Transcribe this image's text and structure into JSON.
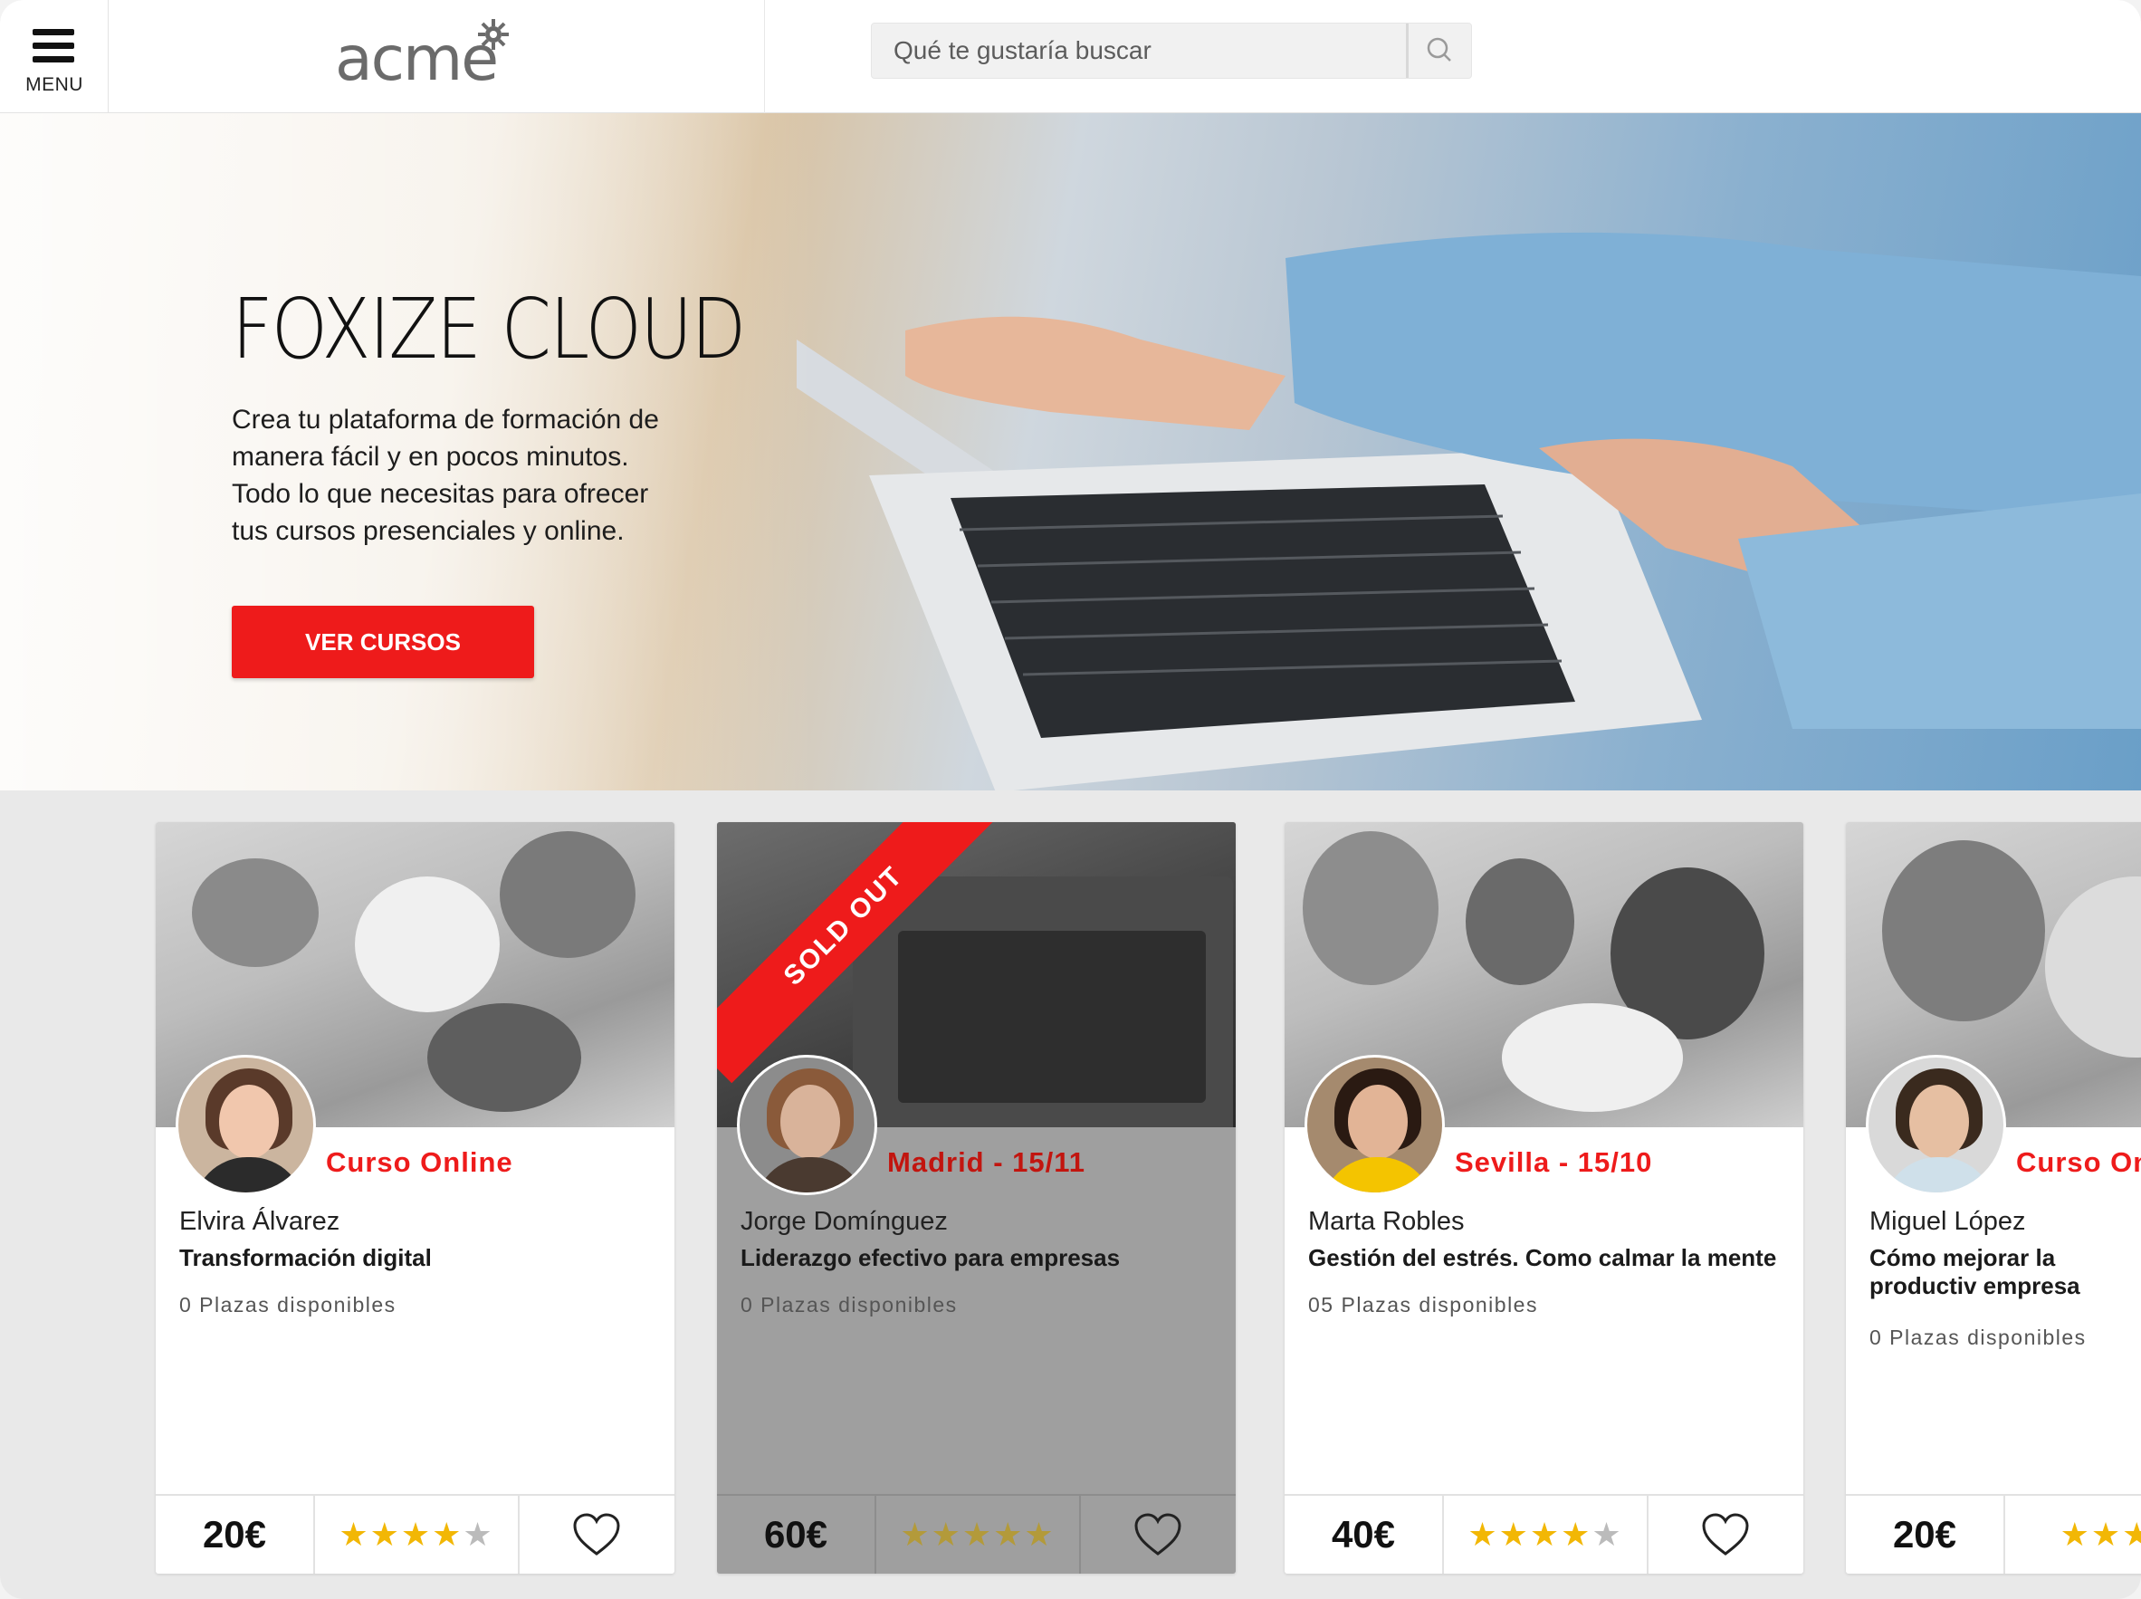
{
  "header": {
    "menu_label": "MENU",
    "logo_text": "acme",
    "search_placeholder": "Qué te gustaría buscar"
  },
  "hero": {
    "title": "FOXIZE CLOUD",
    "description_lines": [
      "Crea tu plataforma de formación de",
      "manera fácil y en pocos minutos.",
      "Todo lo que necesitas para ofrecer",
      "tus cursos presenciales y online."
    ],
    "cta_label": "VER CURSOS"
  },
  "colors": {
    "accent": "#ee1b1b",
    "star": "#f2b705",
    "sold_out_overlay": "#9f9f9f"
  },
  "cards": [
    {
      "tag": "Curso Online",
      "name": "Elvira Álvarez",
      "course": "Transformación digital",
      "seats": "0 Plazas disponibles",
      "price": "20€",
      "rating": 4.5,
      "sold_out": false
    },
    {
      "ribbon": "SOLD OUT",
      "tag": "Madrid - 15/11",
      "name": "Jorge Domínguez",
      "course": "Liderazgo efectivo para empresas",
      "seats": "0 Plazas disponibles",
      "price": "60€",
      "rating": 5,
      "sold_out": true
    },
    {
      "tag": "Sevilla - 15/10",
      "name": "Marta Robles",
      "course": "Gestión del estrés. Como calmar la mente",
      "seats": "05 Plazas disponibles",
      "price": "40€",
      "rating": 4.5,
      "sold_out": false
    },
    {
      "tag": "Curso On",
      "name": "Miguel López",
      "course": "Cómo mejorar la productiv empresa",
      "seats": "0 Plazas disponibles",
      "price": "20€",
      "rating": 3,
      "sold_out": false
    }
  ],
  "icons": {
    "menu": "hamburger-icon",
    "search": "magnifier-icon",
    "favorite": "heart-outline-icon",
    "rating": "star-icon"
  }
}
